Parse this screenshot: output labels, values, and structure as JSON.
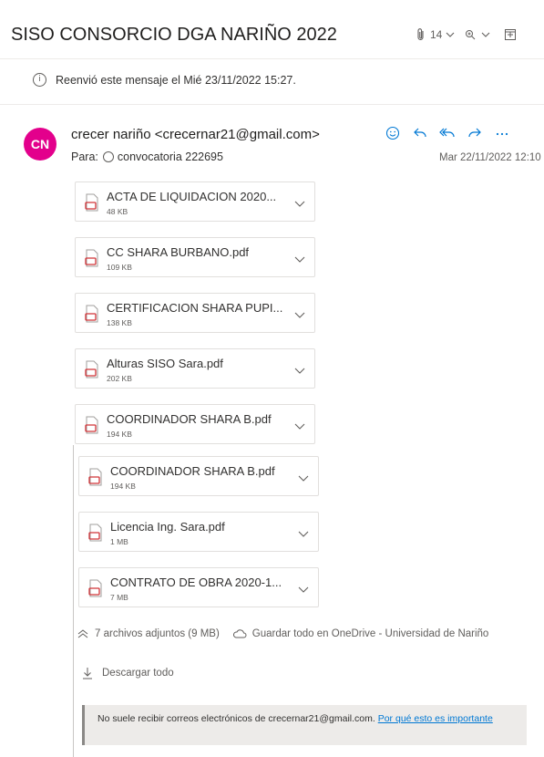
{
  "header": {
    "subject": "SISO CONSORCIO DGA NARIÑO 2022",
    "attachment_count": "14",
    "icons": [
      "paperclip-icon",
      "chevron-down-icon",
      "zoom-icon",
      "chevron-down-icon",
      "open-window-icon"
    ]
  },
  "forward_notice": "Reenvió este mensaje el Mié 23/11/2022 15:27.",
  "message": {
    "avatar_initials": "CN",
    "avatar_color": "#e3008c",
    "sender": "crecer nariño <crecernar21@gmail.com>",
    "to_label": "Para:",
    "recipient": "convocatoria 222695",
    "date": "Mar 22/11/2022 12:10",
    "actions": [
      "emoji-icon",
      "reply-icon",
      "reply-all-icon",
      "forward-icon",
      "more-icon"
    ]
  },
  "attachments": [
    {
      "name": "ACTA DE LIQUIDACION 2020...",
      "size": "48 KB"
    },
    {
      "name": "CC SHARA BURBANO.pdf",
      "size": "109 KB"
    },
    {
      "name": "CERTIFICACION SHARA PUPI...",
      "size": "138 KB"
    },
    {
      "name": "Alturas SISO Sara.pdf",
      "size": "202 KB"
    },
    {
      "name": "COORDINADOR SHARA B.pdf",
      "size": "194 KB"
    },
    {
      "name": "COORDINADOR SHARA B.pdf",
      "size": "194 KB"
    },
    {
      "name": "Licencia Ing. Sara.pdf",
      "size": "1 MB"
    },
    {
      "name": "CONTRATO DE OBRA 2020-1...",
      "size": "7 MB"
    }
  ],
  "summary": {
    "attachments_text": "7 archivos adjuntos (9 MB)",
    "save_all_text": "Guardar todo en OneDrive - Universidad de Nariño"
  },
  "download_all": "Descargar todo",
  "warning": {
    "text": "No suele recibir correos electrónicos de crecernar21@gmail.com.",
    "link": "Por qué esto es importante"
  },
  "colors": {
    "accent": "#0078d4",
    "pdf_red": "#d13438"
  }
}
